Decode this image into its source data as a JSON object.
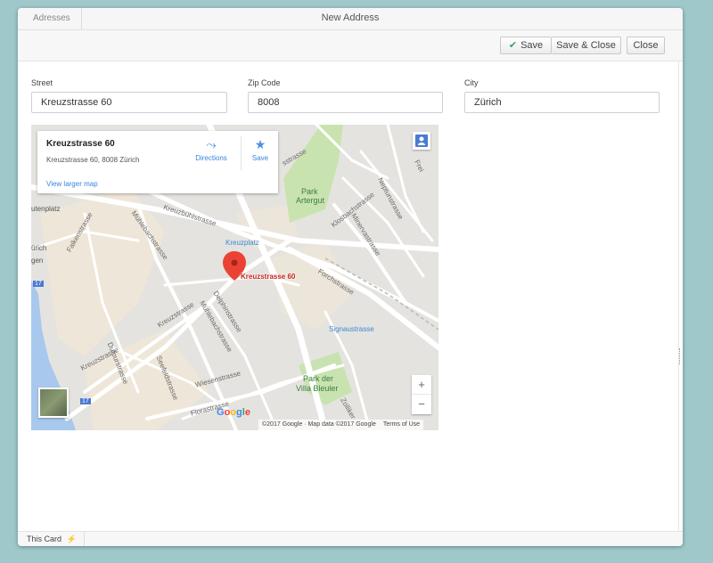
{
  "window": {
    "breadcrumb": "Adresses",
    "title": "New Address"
  },
  "toolbar": {
    "save_label": "Save",
    "save_close_label": "Save & Close",
    "close_label": "Close",
    "save_icon": "check-icon"
  },
  "form": {
    "street": {
      "label": "Street",
      "value": "Kreuzstrasse 60"
    },
    "zip": {
      "label": "Zip Code",
      "value": "8008"
    },
    "city": {
      "label": "City",
      "value": "Zürich"
    }
  },
  "map": {
    "card_title": "Kreuzstrasse 60",
    "card_address": "Kreuzstrasse 60, 8008 Zürich",
    "card_link": "View larger map",
    "directions_label": "Directions",
    "save_label": "Save",
    "pin_label": "Kreuzstrasse 60",
    "attribution": "©2017 Google · Map data ©2017 Google",
    "terms": "Terms of Use",
    "zoom_in": "+",
    "zoom_out": "−",
    "logo": "Google",
    "places": {
      "park1_a": "Park",
      "park1_b": "Artergut",
      "park2_a": "Park der",
      "park2_b": "Villa Bleuler",
      "kreuzplatz": "Kreuzplatz",
      "signaustrasse": "Signaustrasse",
      "zurich": "ürich",
      "gen": "gen",
      "platz": "utenplatz",
      "route1": "17",
      "route2": "17"
    },
    "streets": {
      "kreuzbuehl": "Kreuzbühlstrasse",
      "muehlebach1": "Mühlebachstrasse",
      "muehlebach2": "Mühlebachstrasse",
      "falken": "Falkenstrasse",
      "kreuz1": "Kreuzstrasse",
      "kreuz2": "Kreuzstrasse",
      "forch": "Forchstrasse",
      "klosbach": "Klosbachstrasse",
      "minerva": "Minervastrasse",
      "neptun": "Neptunstrasse",
      "delphin": "Delphinstrasse",
      "dufour": "Dufourstrasse",
      "seefeld": "Seefeldstrasse",
      "wiesen": "Wiesenstrasse",
      "flora": "Florastrasse",
      "zollikerstr": "Zolliker",
      "top": "sstrasse",
      "frei": "Frei"
    }
  },
  "footer": {
    "this_card": "This Card",
    "lightning_icon": "lightning-icon"
  }
}
